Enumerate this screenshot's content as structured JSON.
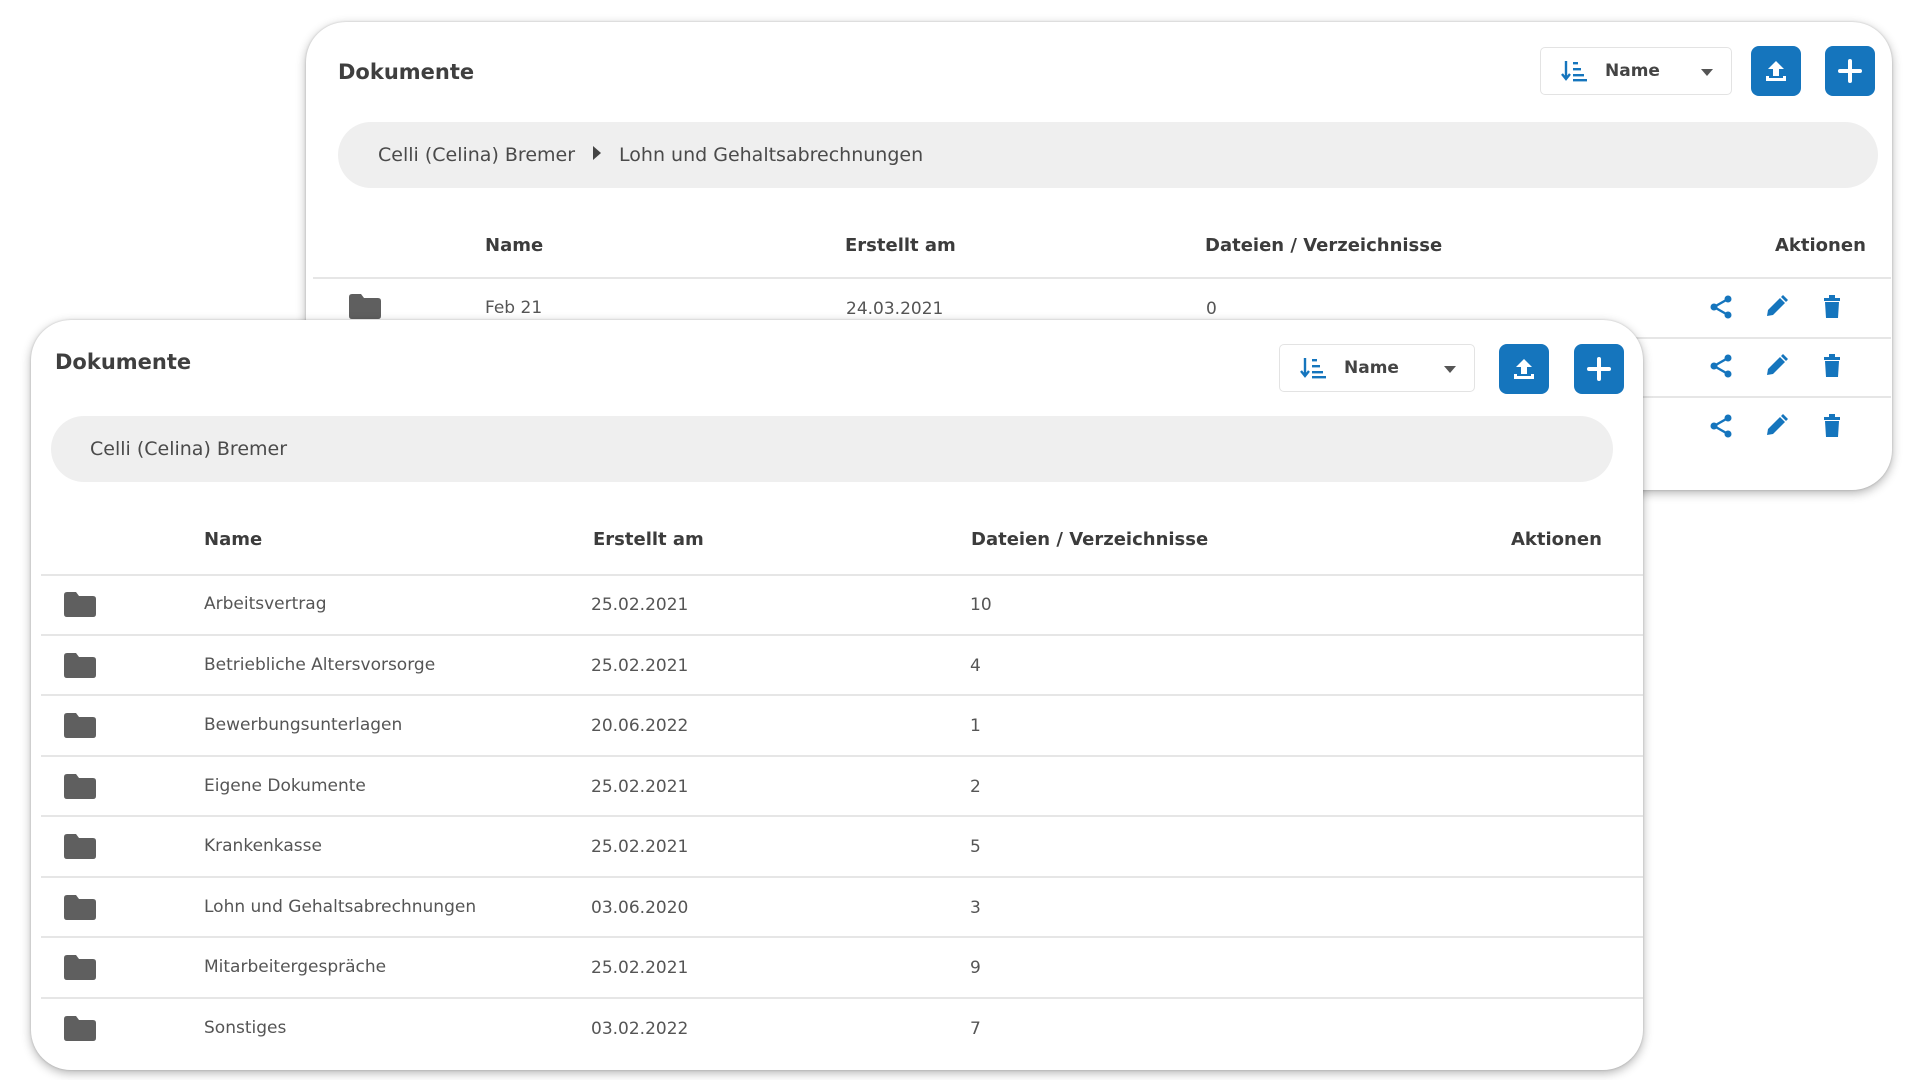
{
  "back_panel": {
    "title": "Dokumente",
    "sort": {
      "label": "Name"
    },
    "breadcrumb": [
      "Celli (Celina) Bremer",
      "Lohn und Gehaltsabrechnungen"
    ],
    "columns": {
      "name": "Name",
      "created": "Erstellt am",
      "files": "Dateien / Verzeichnisse",
      "actions": "Aktionen"
    },
    "rows": [
      {
        "name": "Feb 21",
        "created": "24.03.2021",
        "files": "0"
      }
    ],
    "visible_action_rows": 3
  },
  "front_panel": {
    "title": "Dokumente",
    "sort": {
      "label": "Name"
    },
    "breadcrumb": [
      "Celli (Celina) Bremer"
    ],
    "columns": {
      "name": "Name",
      "created": "Erstellt am",
      "files": "Dateien / Verzeichnisse",
      "actions": "Aktionen"
    },
    "rows": [
      {
        "name": "Arbeitsvertrag",
        "created": "25.02.2021",
        "files": "10"
      },
      {
        "name": "Betriebliche Altersvorsorge",
        "created": "25.02.2021",
        "files": "4"
      },
      {
        "name": "Bewerbungsunterlagen",
        "created": "20.06.2022",
        "files": "1"
      },
      {
        "name": "Eigene Dokumente",
        "created": "25.02.2021",
        "files": "2"
      },
      {
        "name": "Krankenkasse",
        "created": "25.02.2021",
        "files": "5"
      },
      {
        "name": "Lohn und Gehaltsabrechnungen",
        "created": "03.06.2020",
        "files": "3"
      },
      {
        "name": "Mitarbeitergespräche",
        "created": "25.02.2021",
        "files": "9"
      },
      {
        "name": "Sonstiges",
        "created": "03.02.2022",
        "files": "7"
      }
    ]
  },
  "icons": {
    "sort": "sort-amount-down-icon",
    "upload": "upload-icon",
    "add": "plus-icon",
    "folder": "folder-icon",
    "share": "share-icon",
    "edit": "pencil-icon",
    "delete": "trash-icon",
    "breadcrumb_separator": "caret-right-icon"
  },
  "colors": {
    "accent": "#1575bd",
    "folder": "#5f5f5f",
    "breadcrumb_bg": "#efefef"
  }
}
